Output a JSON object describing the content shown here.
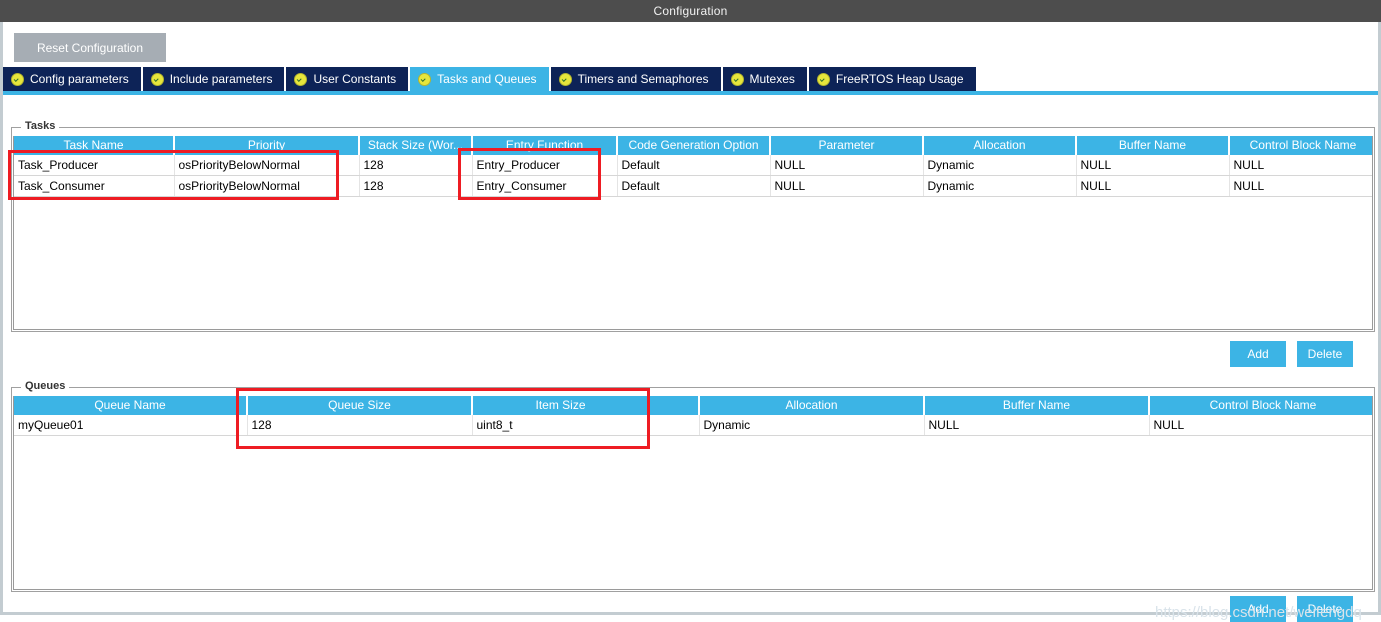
{
  "window": {
    "title": "Configuration"
  },
  "toolbar": {
    "reset_label": "Reset Configuration"
  },
  "tabs": [
    {
      "label": "Config parameters",
      "icon": "check-circle-icon",
      "active": false
    },
    {
      "label": "Include parameters",
      "icon": "check-circle-icon",
      "active": false
    },
    {
      "label": "User Constants",
      "icon": "check-circle-icon",
      "active": false
    },
    {
      "label": "Tasks and Queues",
      "icon": "check-circle-icon",
      "active": true
    },
    {
      "label": "Timers and Semaphores",
      "icon": "check-circle-icon",
      "active": false
    },
    {
      "label": "Mutexes",
      "icon": "check-circle-icon",
      "active": false
    },
    {
      "label": "FreeRTOS Heap Usage",
      "icon": "check-circle-icon",
      "active": false
    }
  ],
  "tasks": {
    "legend": "Tasks",
    "columns": [
      "Task Name",
      "Priority",
      "Stack Size (Wor...",
      "Entry Function",
      "Code Generation Option",
      "Parameter",
      "Allocation",
      "Buffer Name",
      "Control Block Name"
    ],
    "rows": [
      [
        "Task_Producer",
        "osPriorityBelowNormal",
        "128",
        "Entry_Producer",
        "Default",
        "NULL",
        "Dynamic",
        "NULL",
        "NULL"
      ],
      [
        "Task_Consumer",
        "osPriorityBelowNormal",
        "128",
        "Entry_Consumer",
        "Default",
        "NULL",
        "Dynamic",
        "NULL",
        "NULL"
      ]
    ],
    "add_label": "Add",
    "delete_label": "Delete"
  },
  "queues": {
    "legend": "Queues",
    "columns": [
      "Queue Name",
      "Queue Size",
      "Item Size",
      "",
      "Allocation",
      "Buffer Name",
      "Control Block Name"
    ],
    "rows": [
      [
        "myQueue01",
        "128",
        "uint8_t",
        "",
        "Dynamic",
        "NULL",
        "NULL"
      ]
    ],
    "add_label": "Add",
    "delete_label": "Delete"
  },
  "annotations": {
    "highlight_color": "#ee1c23",
    "boxes": [
      {
        "name": "tasks-name-priority-highlight"
      },
      {
        "name": "tasks-entry-function-highlight"
      },
      {
        "name": "queues-size-itemsize-highlight"
      }
    ]
  },
  "watermark": {
    "text": "https://blog.csdn.net/weifengdq"
  },
  "colors": {
    "accent": "#3cb4e5",
    "tab_inactive": "#0d2357",
    "titlebar": "#4d4d4d",
    "frame": "#c3ccd1"
  }
}
